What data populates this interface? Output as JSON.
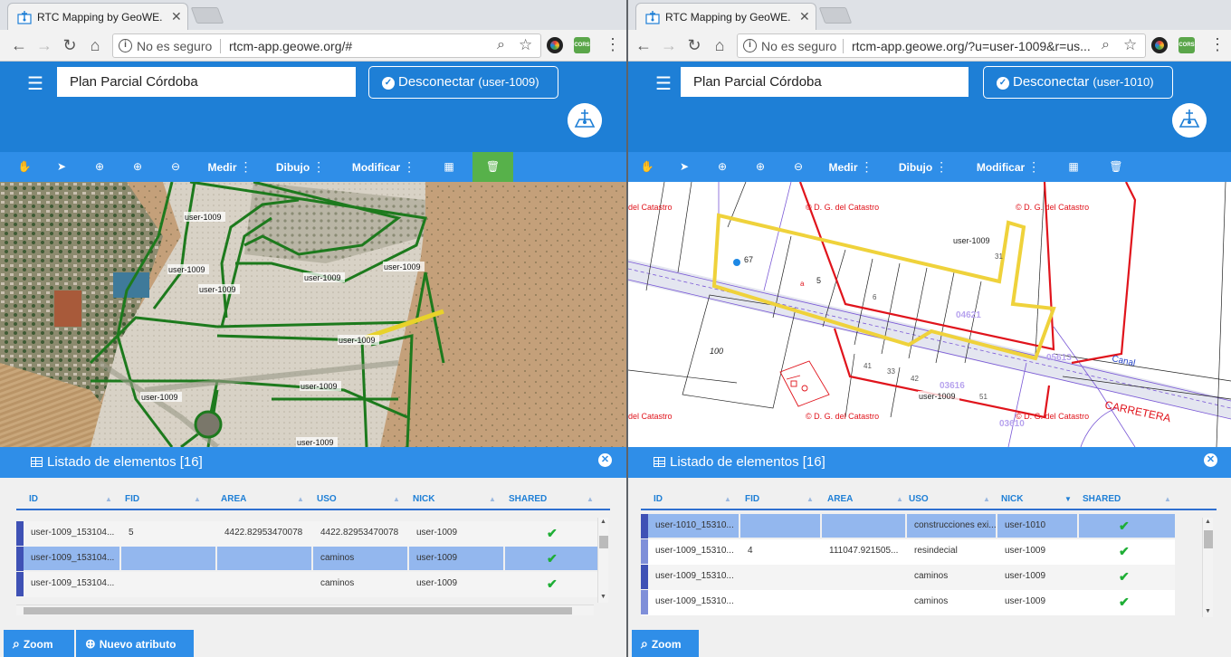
{
  "left": {
    "tab_title": "RTC Mapping by GeoWE.",
    "window_user": "",
    "security": "No es seguro",
    "url": "rtcm-app.geowe.org/#",
    "project": "Plan Parcial Córdoba",
    "disconnect_label": "Desconectar",
    "disconnect_user": "(user-1009)",
    "toolbar": {
      "measure": "Medir",
      "draw": "Dibujo",
      "modify": "Modificar"
    },
    "list_title": "Listado de elementos [16]",
    "columns": [
      "ID",
      "FID",
      "AREA",
      "USO",
      "NICK",
      "SHARED"
    ],
    "rows": [
      {
        "id": "user-1009_153104...",
        "fid": "5",
        "area": "4422.82953470078",
        "uso": "4422.82953470078",
        "nick": "user-1009",
        "shared": "✔"
      },
      {
        "id": "user-1009_153104...",
        "fid": "",
        "area": "",
        "uso": "caminos",
        "nick": "user-1009",
        "shared": "✔"
      },
      {
        "id": "user-1009_153104...",
        "fid": "",
        "area": "",
        "uso": "caminos",
        "nick": "user-1009",
        "shared": "✔"
      }
    ],
    "zoom_btn": "Zoom",
    "new_attr_btn": "Nuevo atributo",
    "map_labels": [
      "user-1009",
      "user-1009",
      "user-1009",
      "user-1009",
      "user-1009",
      "user-1009",
      "user-1009",
      "user-1009",
      "user-1009"
    ]
  },
  "right": {
    "tab_title": "RTC Mapping by GeoWE.",
    "window_user": "",
    "security": "No es seguro",
    "url": "rtcm-app.geowe.org/?u=user-1009&r=us...",
    "project": "Plan Parcial Córdoba",
    "disconnect_label": "Desconectar",
    "disconnect_user": "(user-1010)",
    "toolbar": {
      "measure": "Medir",
      "draw": "Dibujo",
      "modify": "Modificar"
    },
    "list_title": "Listado de elementos [16]",
    "columns": [
      "ID",
      "FID",
      "AREA",
      "USO",
      "NICK",
      "SHARED"
    ],
    "rows": [
      {
        "id": "user-1010_15310...",
        "fid": "",
        "area": "",
        "uso": "construcciones exi...",
        "nick": "user-1010",
        "shared": "✔"
      },
      {
        "id": "user-1009_15310...",
        "fid": "4",
        "area": "111047.921505...",
        "uso": "resindecial",
        "nick": "user-1009",
        "shared": "✔"
      },
      {
        "id": "user-1009_15310...",
        "fid": "",
        "area": "",
        "uso": "caminos",
        "nick": "user-1009",
        "shared": "✔"
      },
      {
        "id": "user-1009_15310...",
        "fid": "",
        "area": "",
        "uso": "caminos",
        "nick": "user-1009",
        "shared": "✔"
      }
    ],
    "zoom_btn": "Zoom",
    "map_labels": {
      "catastro": "© D. G. del Catastro",
      "catastro_short": "del Catastro",
      "user_a": "user-1009",
      "user_b": "user-1009",
      "p67": "67",
      "p5": "5",
      "pa": "a",
      "p6": "6",
      "p31": "31",
      "p100": "100",
      "p41": "41",
      "p33": "33",
      "p42": "42",
      "p51": "51",
      "z04621": "04621",
      "z05613": "05613",
      "z03616": "03616",
      "z03610": "03610",
      "canal": "Canal",
      "carretera": "CARRETERA"
    }
  },
  "colors": {
    "header": "#1e7fd6",
    "toolbar": "#2f8ee8",
    "selected_tool": "#57b14a",
    "selected_row": "#93b7ee",
    "check": "#1eae35"
  }
}
